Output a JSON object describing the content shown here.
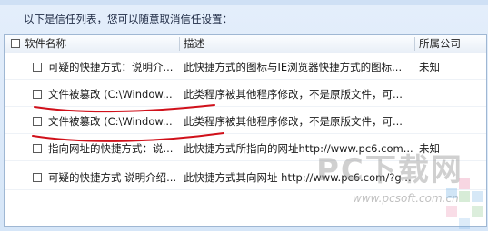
{
  "notice": "以下是信任列表，您可以随意取消信任设置：",
  "table": {
    "columns": [
      "软件名称",
      "描述",
      "所属公司"
    ],
    "rows": [
      {
        "name": "可疑的快捷方式：说明介...",
        "desc": "此快捷方式的图标与IE浏览器快捷方式的图标...",
        "company": "未知"
      },
      {
        "name": "文件被篡改 (C:\\Window...",
        "desc": "此类程序被其他程序修改，不是原版文件，可...",
        "company": ""
      },
      {
        "name": "文件被篡改 (C:\\Window...",
        "desc": "此类程序被其他程序修改，不是原版文件，可...",
        "company": ""
      },
      {
        "name": "指向网址的快捷方式：说...",
        "desc": "此快捷方式所指向的网址http://www.pc6.com...",
        "company": "未知"
      },
      {
        "name": "可疑的快捷方式 说明介绍...",
        "desc": "此快捷方式其向网址 http://www.pc6.com/?g...",
        "company": ""
      }
    ]
  },
  "watermark": {
    "big": "PC下载网",
    "small": "www.pcsoft.com.cn"
  },
  "colors": {
    "annotation_red": "#d0101a",
    "header_bg": "#eef3fa",
    "panel_border": "#9fb7d3"
  }
}
